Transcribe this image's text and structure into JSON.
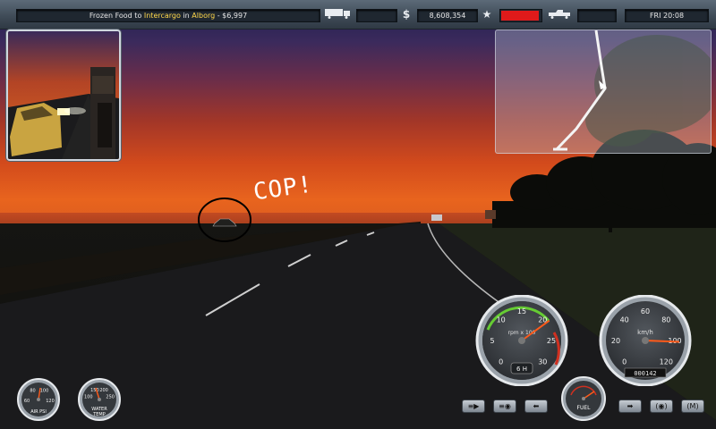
{
  "hud": {
    "mission_prefix": "Frozen Food to ",
    "mission_company": "Intercargo",
    "mission_in": " in ",
    "mission_city": "Alborg",
    "mission_value": " - $6,997",
    "money_symbol": "$",
    "money": "8,608,354",
    "datetime": "FRI 20:08",
    "damage_level": 0.95
  },
  "icons": {
    "cargo": "truck-trailer-icon",
    "money": "dollar-icon",
    "rating": "star-icon",
    "truck": "truck-icon"
  },
  "annotation": {
    "text": "COP!"
  },
  "gauges": {
    "tachometer": {
      "unit": "rpm x 100",
      "ticks": [
        "0",
        "5",
        "10",
        "15",
        "20",
        "25",
        "30"
      ],
      "gear": "6 H",
      "needle_value": 21
    },
    "speedometer": {
      "unit": "km/h",
      "ticks": [
        "0",
        "20",
        "40",
        "60",
        "80",
        "100",
        "120"
      ],
      "odometer": "000142",
      "needle_value": 101
    },
    "air_psi": {
      "label": "AIR PSI",
      "ticks": [
        "60",
        "80",
        "100",
        "120"
      ]
    },
    "water_temp": {
      "label": "WATER TEMP",
      "ticks": [
        "100",
        "150",
        "200",
        "250"
      ]
    },
    "fuel": {
      "label": "FUEL"
    }
  },
  "buttons": {
    "low_beam": "≡▶",
    "high_beam": "≡◉",
    "left_signal": "⬅",
    "right_signal": "➡",
    "hazard": "(◉)",
    "map": "(M)"
  }
}
